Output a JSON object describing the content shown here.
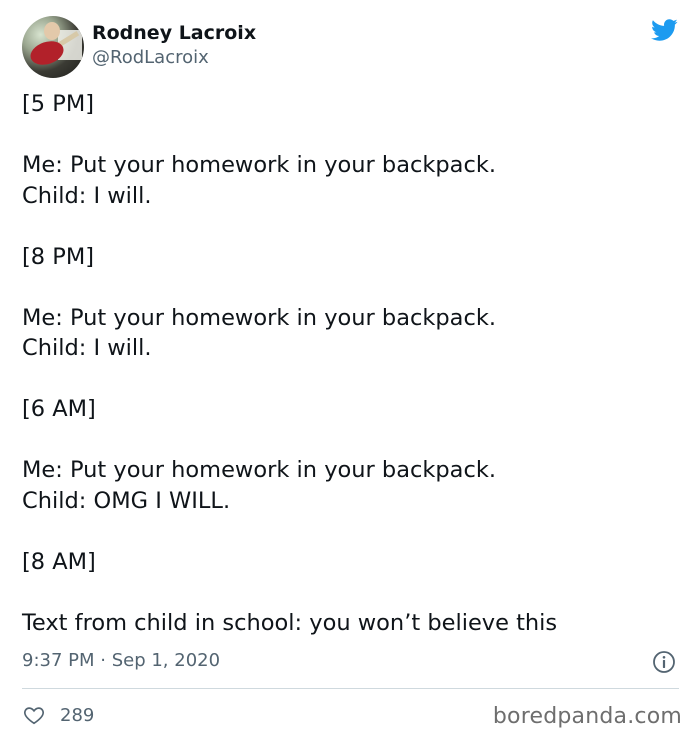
{
  "tweet": {
    "author_name": "Rodney Lacroix",
    "author_handle": "@RodLacroix",
    "lines": [
      "[5 PM]",
      "",
      "Me: Put your homework in your backpack.",
      "Child: I will.",
      "",
      "[8 PM]",
      "",
      "Me: Put your homework in your backpack.",
      "Child: I will.",
      "",
      "[6 AM]",
      "",
      "Me: Put your homework in your backpack.",
      "Child: OMG I WILL.",
      "",
      "[8 AM]",
      "",
      "Text from child in school: you won’t believe this"
    ],
    "timestamp": "9:37 PM · Sep 1, 2020",
    "like_count": "289"
  },
  "watermark": "boredpanda.com",
  "icons": {
    "brand": "twitter-bird-icon",
    "info": "info-icon",
    "like": "heart-icon"
  },
  "colors": {
    "twitter_blue": "#1d9bf0",
    "text": "#0f1419",
    "secondary_text": "#536471",
    "divider": "#cfd9de"
  }
}
